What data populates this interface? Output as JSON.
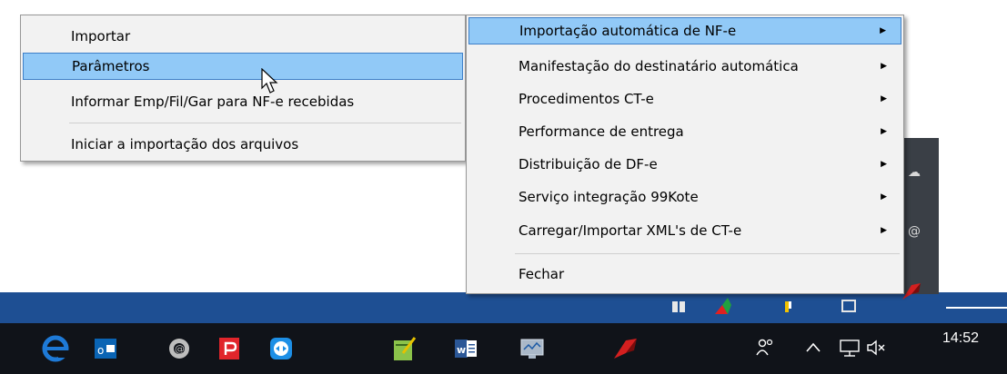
{
  "menu_primary": {
    "items": [
      {
        "label": "Importar",
        "highlighted": false
      },
      {
        "label": "Parâmetros",
        "highlighted": true
      },
      {
        "label": "Informar Emp/Fil/Gar para NF-e recebidas",
        "highlighted": false
      },
      {
        "label": "Iniciar a importação dos arquivos",
        "highlighted": false
      }
    ]
  },
  "menu_submenu": {
    "items": [
      {
        "label": "Importação automática de NF-e",
        "highlighted": true,
        "has_submenu": true
      },
      {
        "label": "Manifestação do destinatário automática",
        "has_submenu": true
      },
      {
        "label": "Procedimentos CT-e",
        "has_submenu": true
      },
      {
        "label": "Performance de entrega",
        "has_submenu": true
      },
      {
        "label": "Distribuição de DF-e",
        "has_submenu": true
      },
      {
        "label": "Serviço integração 99Kote",
        "has_submenu": true
      },
      {
        "label": "Carregar/Importar XML's de CT-e",
        "has_submenu": true
      },
      {
        "label": "Fechar",
        "has_submenu": false
      }
    ]
  },
  "taskbar": {
    "clock": "14:52",
    "apps": [
      "edge-icon",
      "outlook-icon",
      "lotus-icon",
      "pdf-icon",
      "teamviewer-icon",
      "notepad-icon",
      "word-icon",
      "monitor-icon",
      "app-icon"
    ]
  },
  "colors": {
    "highlight": "#91c9f7",
    "taskbar": "#101319",
    "accent_strip": "#1e4f93"
  }
}
